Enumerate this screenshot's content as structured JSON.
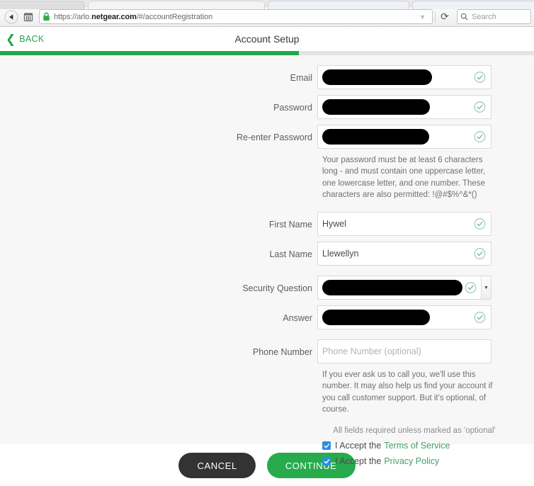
{
  "browser": {
    "back_icon": "arrow-left-icon",
    "bookmarks_icon": "bookmarks-icon",
    "lock_icon": "padlock-icon",
    "url": "https://arlo.netgear.com/#/accountRegistration",
    "url_prefix": "https://arlo.",
    "url_domain": "netgear.com",
    "url_suffix": "/#/accountRegistration",
    "dropdown_icon": "chevron-down-icon",
    "reload_icon": "reload-icon",
    "reload_glyph": "⟳",
    "search_icon": "search-icon",
    "search_placeholder": "Search"
  },
  "header": {
    "back_label": "BACK",
    "back_icon": "chevron-left-icon",
    "title": "Account Setup",
    "progress_percent": 56,
    "accent_green": "#22a84c",
    "track_gray": "#e4e4e4"
  },
  "form": {
    "fields": [
      {
        "name": "email",
        "label": "Email",
        "value": "",
        "redacted": true,
        "valid": true,
        "type": "text"
      },
      {
        "name": "password",
        "label": "Password",
        "value": "",
        "redacted": true,
        "valid": true,
        "type": "password"
      },
      {
        "name": "reenter-password",
        "label": "Re-enter Password",
        "value": "",
        "redacted": true,
        "valid": true,
        "type": "password"
      },
      {
        "name": "first-name",
        "label": "First Name",
        "value": "Hywel",
        "redacted": false,
        "valid": true,
        "type": "text"
      },
      {
        "name": "last-name",
        "label": "Last Name",
        "value": "Llewellyn",
        "redacted": false,
        "valid": true,
        "type": "text"
      },
      {
        "name": "security-question",
        "label": "Security Question",
        "value": "",
        "redacted": true,
        "valid": true,
        "type": "select"
      },
      {
        "name": "answer",
        "label": "Answer",
        "value": "",
        "redacted": true,
        "valid": true,
        "type": "text"
      },
      {
        "name": "phone-number",
        "label": "Phone Number",
        "value": "",
        "placeholder": "Phone Number (optional)",
        "redacted": false,
        "valid": false,
        "type": "tel"
      }
    ],
    "password_hint": "Your password must be at least 6 characters long - and must contain one uppercase letter, one lowercase letter, and one number. These characters are also permitted: !@#$%^&*()",
    "phone_hint": "If you ever ask us to call you, we'll use this number. It may also help us find your account if you call customer support. But it's optional, of course.",
    "all_fields_note": "All fields required unless marked as 'optional'",
    "check_icon": "check-circle-icon",
    "select_arrow_icon": "chevron-down-icon",
    "consents": [
      {
        "name": "terms-of-service",
        "checked": true,
        "text": "I Accept the",
        "link": "Terms of Service"
      },
      {
        "name": "privacy-policy",
        "checked": true,
        "text": "I Accept the",
        "link": "Privacy Policy"
      }
    ]
  },
  "footer": {
    "cancel_label": "CANCEL",
    "continue_label": "CONTINUE",
    "cancel_color": "#333333",
    "continue_color": "#27ab4d"
  }
}
